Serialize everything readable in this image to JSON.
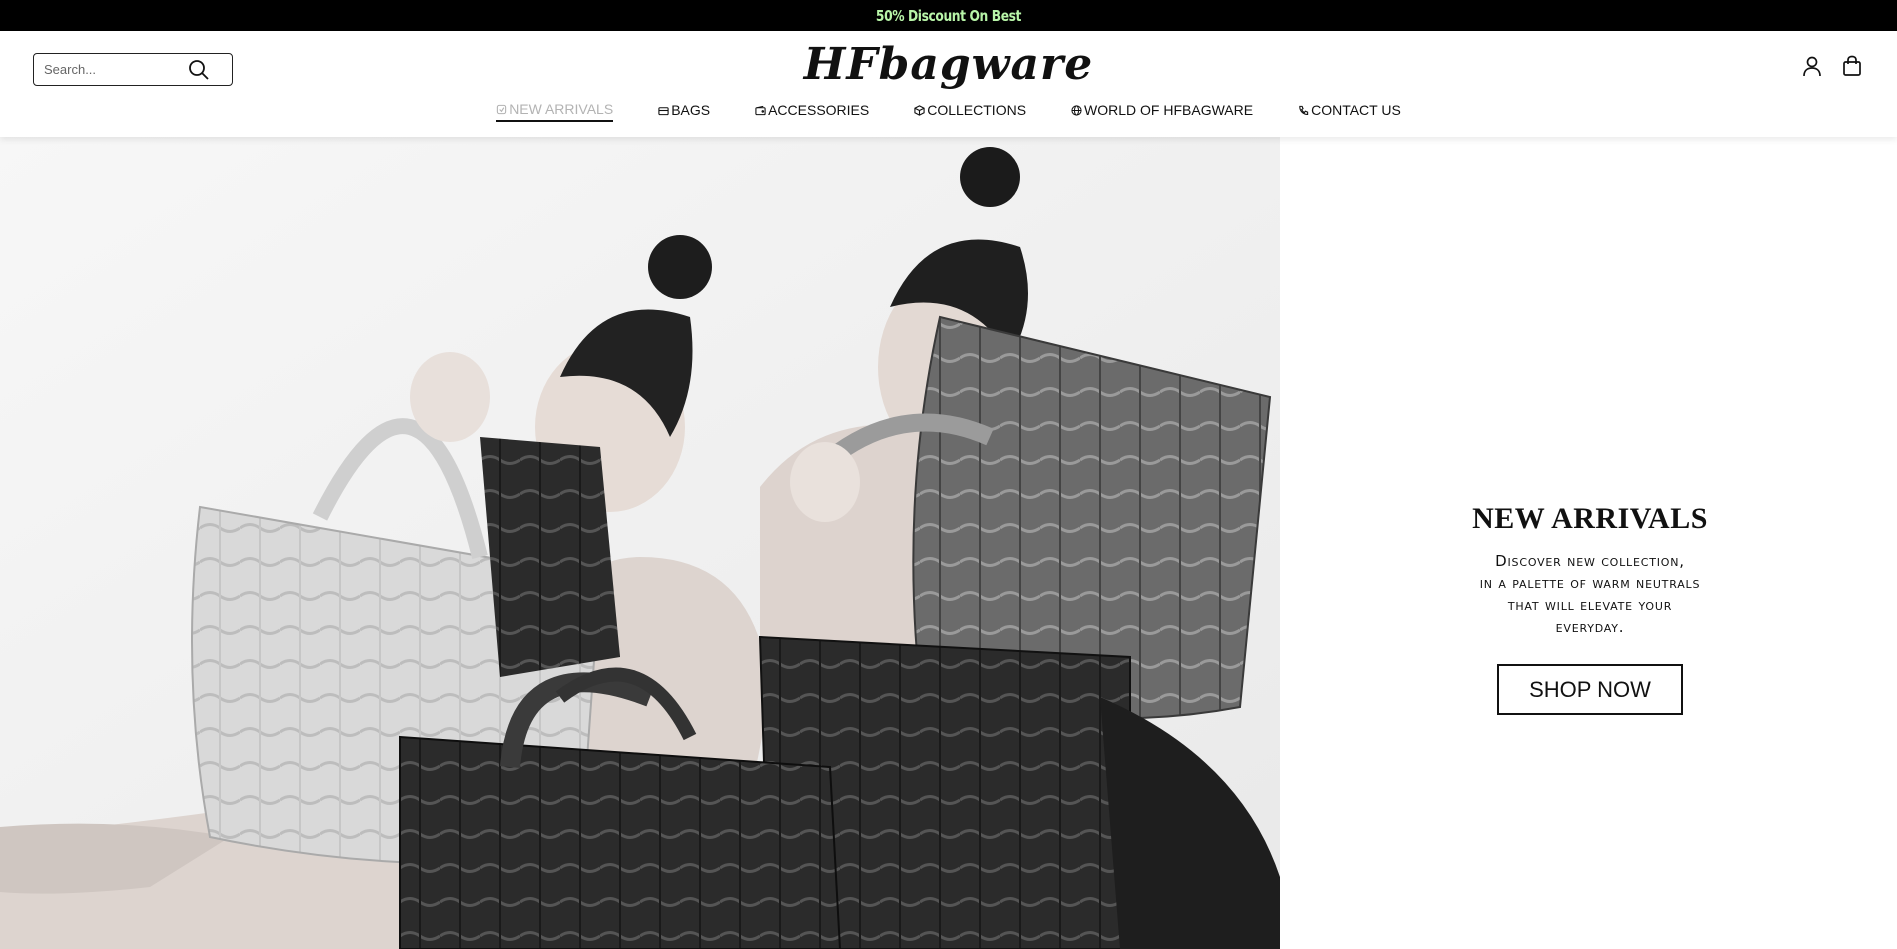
{
  "announcement": {
    "text": "50% Discount On Best"
  },
  "header": {
    "search_placeholder": "Search...",
    "logo_text": "HFbagware",
    "icons": [
      "search-icon",
      "account-icon",
      "cart-icon"
    ]
  },
  "nav": {
    "items": [
      {
        "label": "NEW ARRIVALS",
        "icon": "new-icon",
        "active": true
      },
      {
        "label": "BAGS",
        "icon": "bag-icon"
      },
      {
        "label": "ACCESSORIES",
        "icon": "wallet-icon"
      },
      {
        "label": "COLLECTIONS",
        "icon": "box-icon"
      },
      {
        "label": "WORLD OF HFBAGWARE",
        "icon": "globe-icon"
      },
      {
        "label": "CONTACT US",
        "icon": "phone-icon"
      }
    ]
  },
  "hero": {
    "title": "NEW ARRIVALS",
    "text": "Discover new collection,\nin a palette of warm neutrals\nthat will elevate your\neveryday.",
    "button": "SHOP NOW"
  },
  "colors": {
    "announcement_bg": "#000000",
    "announcement_text": "#b8f5a8",
    "active_nav": "#b3b3b3"
  }
}
